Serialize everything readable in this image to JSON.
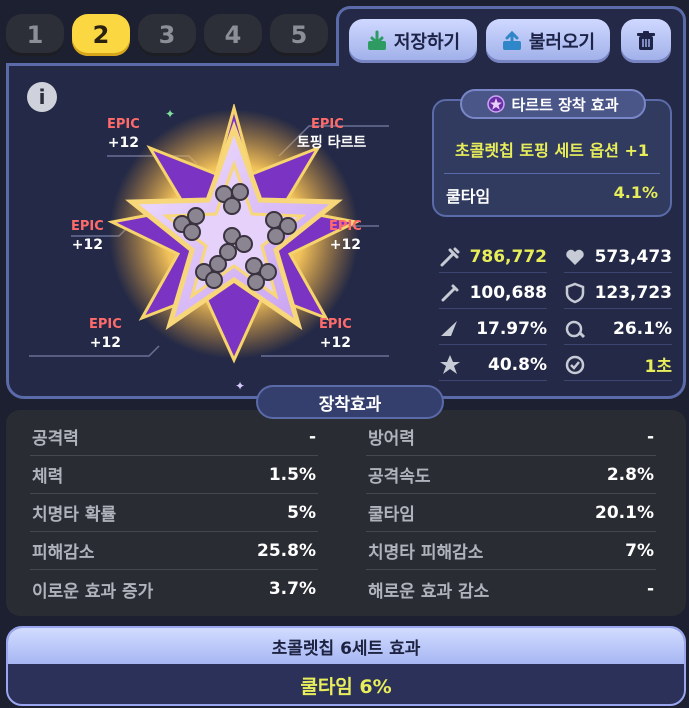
{
  "slots": {
    "tabs": [
      "1",
      "2",
      "3",
      "4",
      "5"
    ],
    "active_index": 1
  },
  "toolbar": {
    "save_label": "저장하기",
    "load_label": "불러오기"
  },
  "info": {
    "label": "i"
  },
  "toppings": [
    {
      "grade": "EPIC",
      "level": "+12"
    },
    {
      "grade": "EPIC",
      "level": "+12"
    },
    {
      "grade": "EPIC",
      "level": "+12"
    },
    {
      "grade": "EPIC",
      "level": "+12"
    },
    {
      "grade": "EPIC",
      "level": "+12"
    },
    {
      "grade": "EPIC",
      "level": "+12"
    }
  ],
  "selected_tag": {
    "grade": "EPIC",
    "name": "토핑 타르트"
  },
  "tart_effect": {
    "title": "타르트 장착 효과",
    "set_option": "초콜렛칩 토핑 세트 옵션 +1",
    "cooldown_label": "쿨타임",
    "cooldown_value": "4.1%"
  },
  "stats": {
    "atk": "786,772",
    "hp": "573,473",
    "def_pen": "100,688",
    "def": "123,723",
    "crit": "17.97%",
    "atk_speed": "26.1%",
    "crit_resist": "40.8%",
    "cooldown": "1초"
  },
  "colors": {
    "highlight_yellow": "#e8ee5a",
    "epic_red": "#ff6b6b",
    "panel_border": "#5b6aa8",
    "active_tab": "#fbd742"
  },
  "equip_effects": {
    "title": "장착효과",
    "left": [
      {
        "label": "공격력",
        "value": "-"
      },
      {
        "label": "체력",
        "value": "1.5%"
      },
      {
        "label": "치명타 확률",
        "value": "5%"
      },
      {
        "label": "피해감소",
        "value": "25.8%"
      },
      {
        "label": "이로운 효과 증가",
        "value": "3.7%"
      }
    ],
    "right": [
      {
        "label": "방어력",
        "value": "-"
      },
      {
        "label": "공격속도",
        "value": "2.8%"
      },
      {
        "label": "쿨타임",
        "value": "20.1%"
      },
      {
        "label": "치명타 피해감소",
        "value": "7%"
      },
      {
        "label": "해로운 효과 감소",
        "value": "-"
      }
    ]
  },
  "set_bonus": {
    "title": "초콜렛칩 6세트 효과",
    "effect": "쿨타임 6%"
  },
  "icons": [
    "save-icon",
    "load-icon",
    "trash-icon",
    "info-icon",
    "tart-icon",
    "attack-icon",
    "heart-icon",
    "sword-icon",
    "shield-icon",
    "crit-icon",
    "atk-speed-icon",
    "crit-resist-icon",
    "cooldown-icon"
  ]
}
